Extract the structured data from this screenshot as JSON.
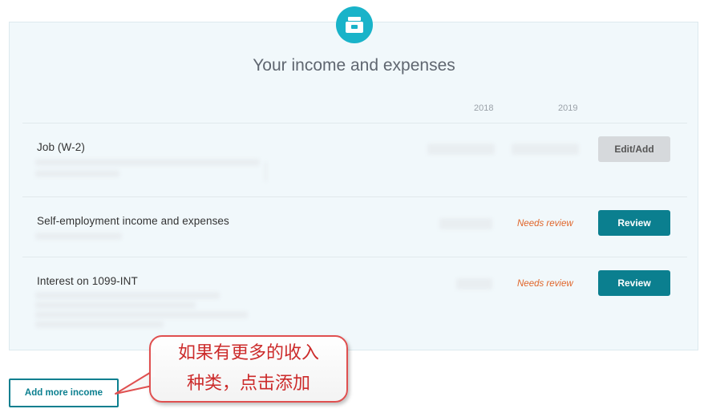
{
  "colors": {
    "accent": "#19b3c9",
    "primary_button": "#0b7f8f",
    "needs_review": "#e0662b",
    "callout_border": "#e05050",
    "callout_text": "#cc2b2b"
  },
  "header": {
    "icon": "cash-register-icon",
    "title": "Your income and expenses"
  },
  "columns": {
    "year1": "2018",
    "year2": "2019"
  },
  "rows": [
    {
      "label": "Job (W-2)",
      "status": "",
      "button": "Edit/Add"
    },
    {
      "label": "Self-employment income and expenses",
      "status": "Needs review",
      "button": "Review"
    },
    {
      "label": "Interest on 1099-INT",
      "status": "Needs review",
      "button": "Review"
    }
  ],
  "add_more": {
    "label": "Add more income"
  },
  "callout": {
    "line1": "如果有更多的收入",
    "line2": "种类，点击添加"
  }
}
